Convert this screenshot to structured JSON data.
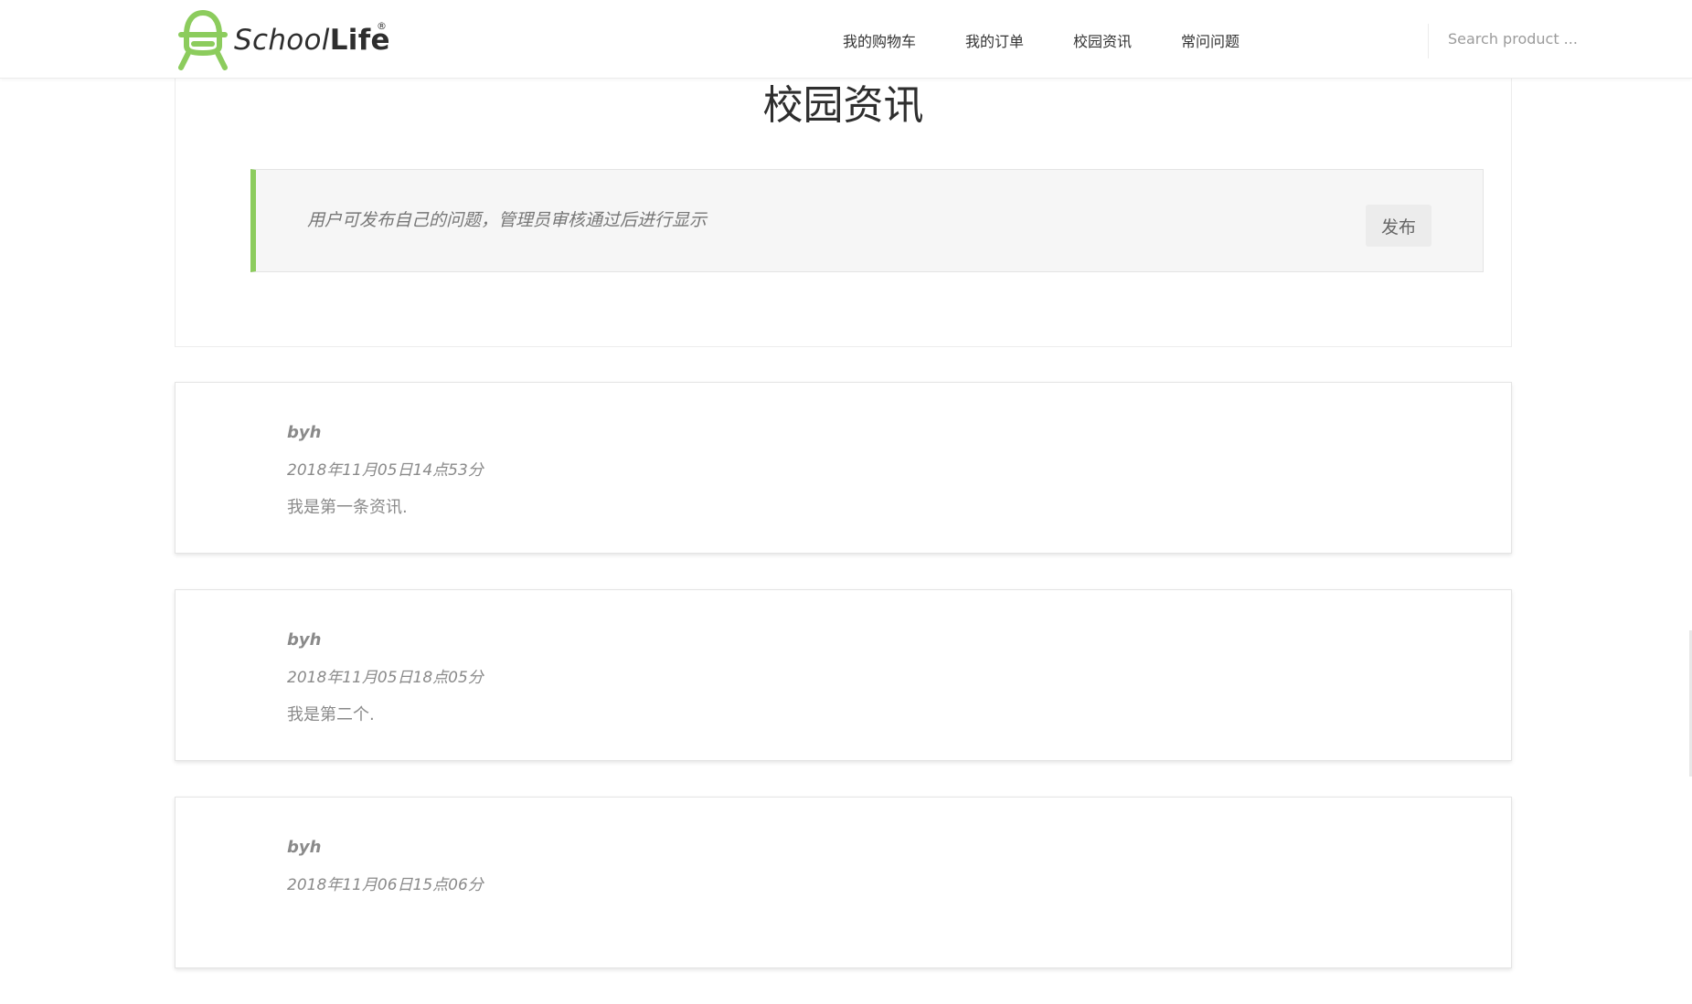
{
  "brand": {
    "name_part1": "School",
    "name_part2": "Life",
    "registered": "®",
    "accent_color": "#8ccc5d"
  },
  "nav": {
    "items": [
      {
        "label": "我的购物车"
      },
      {
        "label": "我的订单"
      },
      {
        "label": "校园资讯"
      },
      {
        "label": "常问问题"
      }
    ]
  },
  "search": {
    "placeholder": "Search product ..."
  },
  "page": {
    "title": "校园资讯"
  },
  "notice": {
    "text": "用户可发布自己的问题，管理员审核通过后进行显示",
    "publish_label": "发布"
  },
  "news": [
    {
      "author": "byh",
      "date": "2018年11月05日14点53分",
      "content": "我是第一条资讯."
    },
    {
      "author": "byh",
      "date": "2018年11月05日18点05分",
      "content": "我是第二个."
    },
    {
      "author": "byh",
      "date": "2018年11月06日15点06分",
      "content": ""
    }
  ]
}
